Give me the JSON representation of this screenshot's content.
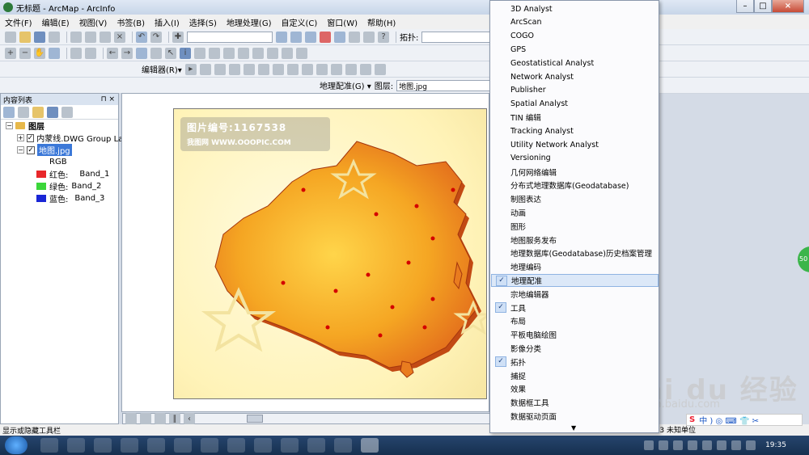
{
  "window": {
    "title": "无标题 - ArcMap - ArcInfo"
  },
  "menubar": [
    "文件(F)",
    "编辑(E)",
    "视图(V)",
    "书签(B)",
    "插入(I)",
    "选择(S)",
    "地理处理(G)",
    "自定义(C)",
    "窗口(W)",
    "帮助(H)"
  ],
  "toolbar1": {
    "topology_label": "拓扑:"
  },
  "toolbar3": {
    "editor_label": "编辑器(R)▾"
  },
  "georef": {
    "label": "地理配准(G) ▾",
    "layer_label": "图层:",
    "layer_value": "地图.jpg"
  },
  "toc": {
    "title": "内容列表",
    "pin": "⊓ ×",
    "root": "图层",
    "layer1": "内蒙线.DWG Group Lay",
    "layer2": "地图.jpg",
    "rgb": "RGB",
    "bands": [
      {
        "label": "红色:",
        "band": "Band_1",
        "color": "#e8272a"
      },
      {
        "label": "绿色:",
        "band": "Band_2",
        "color": "#3bd63a"
      },
      {
        "label": "蓝色:",
        "band": "Band_3",
        "color": "#1a26d6"
      }
    ]
  },
  "map": {
    "watermark_line1": "图片编号:1167538",
    "watermark_line2": "我图网  WWW.OOOPIC.COM"
  },
  "dropdown": {
    "items": [
      {
        "label": "3D Analyst",
        "checked": false
      },
      {
        "label": "ArcScan",
        "checked": false
      },
      {
        "label": "COGO",
        "checked": false
      },
      {
        "label": "GPS",
        "checked": false
      },
      {
        "label": "Geostatistical Analyst",
        "checked": false
      },
      {
        "label": "Network Analyst",
        "checked": false
      },
      {
        "label": "Publisher",
        "checked": false
      },
      {
        "label": "Spatial Analyst",
        "checked": false
      },
      {
        "label": "TIN 编辑",
        "checked": false
      },
      {
        "label": "Tracking Analyst",
        "checked": false
      },
      {
        "label": "Utility Network Analyst",
        "checked": false
      },
      {
        "label": "Versioning",
        "checked": false
      },
      {
        "label": "几何网络编辑",
        "checked": false
      },
      {
        "label": "分布式地理数据库(Geodatabase)",
        "checked": false
      },
      {
        "label": "制图表达",
        "checked": false
      },
      {
        "label": "动画",
        "checked": false
      },
      {
        "label": "图形",
        "checked": false
      },
      {
        "label": "地图服务发布",
        "checked": false
      },
      {
        "label": "地理数据库(Geodatabase)历史档案管理",
        "checked": false
      },
      {
        "label": "地理编码",
        "checked": false
      },
      {
        "label": "地理配准",
        "checked": true,
        "highlighted": true
      },
      {
        "label": "宗地编辑器",
        "checked": false
      },
      {
        "label": "工具",
        "checked": true
      },
      {
        "label": "布局",
        "checked": false
      },
      {
        "label": "平板电脑绘图",
        "checked": false
      },
      {
        "label": "影像分类",
        "checked": false
      },
      {
        "label": "拓扑",
        "checked": true
      },
      {
        "label": "捕捉",
        "checked": false
      },
      {
        "label": "效果",
        "checked": false
      },
      {
        "label": "数据框工具",
        "checked": false
      },
      {
        "label": "数据驱动页面",
        "checked": false
      }
    ],
    "more_arrow": "▼"
  },
  "status": {
    "text": "显示或隐藏工具栏",
    "coords": "12  13.7 13 未知单位"
  },
  "ime": {
    "brand": "S",
    "text": "中 ) ◎ ⌨ 👕 ✂"
  },
  "taskbar": {
    "clock": "19:35"
  },
  "watermark": {
    "brand": "Bai du 经验",
    "url": "jingyan.baidu.com"
  },
  "side_badge": "50"
}
